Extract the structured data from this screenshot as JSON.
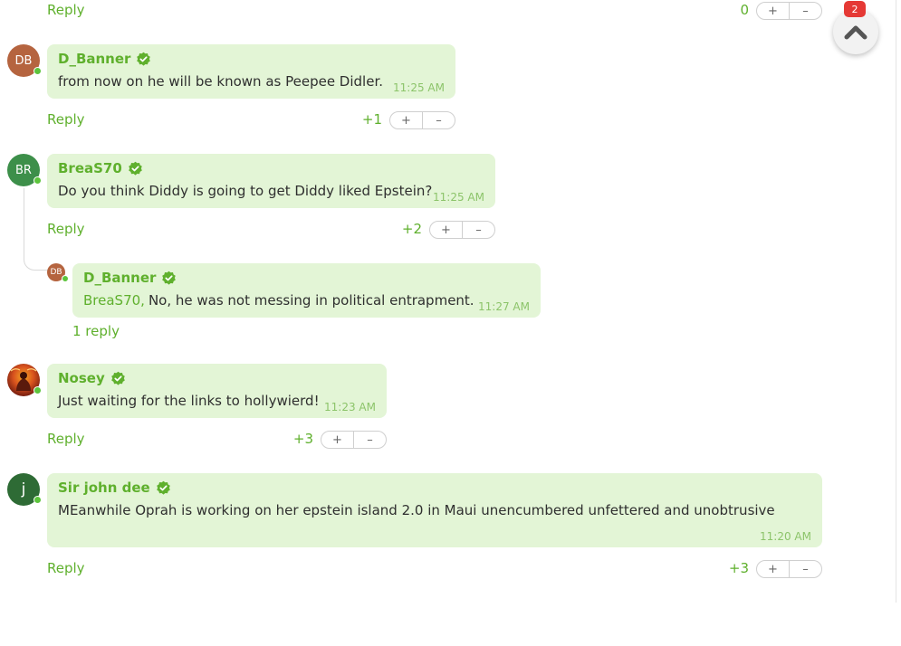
{
  "colors": {
    "accent_green": "#5fb02d",
    "bubble_green": "#e3f5d6",
    "online_dot": "#5cc43c",
    "badge_red": "#e53935"
  },
  "top_row": {
    "reply_label": "Reply",
    "score": "0",
    "upvote": "+",
    "downvote": "–"
  },
  "scroll_top": {
    "icon": "chevron-up-icon",
    "badge": "2"
  },
  "comments": [
    {
      "avatar": {
        "initials": "DB",
        "color": "#b5643f"
      },
      "author": "D_Banner",
      "text": "from now on he will be known as Peepee Didler.",
      "time": "11:25 AM",
      "reply_label": "Reply",
      "score": "+1",
      "upvote": "+",
      "downvote": "–"
    },
    {
      "avatar": {
        "initials": "BR",
        "color": "#3d8f4a"
      },
      "author": "BreaS70",
      "text": "Do you think Diddy is going to get Diddy liked Epstein?",
      "time": "11:25 AM",
      "reply_label": "Reply",
      "score": "+2",
      "upvote": "+",
      "downvote": "–",
      "child": {
        "avatar": {
          "initials": "DB",
          "color": "#b5643f"
        },
        "author": "D_Banner",
        "mention": "BreaS70,",
        "text": "No, he was not messing in political entrapment.",
        "time": "11:27 AM",
        "replies_link": "1 reply"
      }
    },
    {
      "avatar": {
        "initials": "",
        "color": "#a83a1c",
        "image": "fiery-avatar"
      },
      "author": "Nosey",
      "text": "Just waiting for the links to hollywierd!",
      "time": "11:23 AM",
      "reply_label": "Reply",
      "score": "+3",
      "upvote": "+",
      "downvote": "–"
    },
    {
      "avatar": {
        "initials": "j",
        "color": "#2e6b35"
      },
      "author": "Sir john dee",
      "text": "MEanwhile Oprah is working on her epstein island 2.0 in Maui unencumbered unfettered and unobtrusive",
      "time": "11:20 AM",
      "reply_label": "Reply",
      "score": "+3",
      "upvote": "+",
      "downvote": "–"
    }
  ]
}
